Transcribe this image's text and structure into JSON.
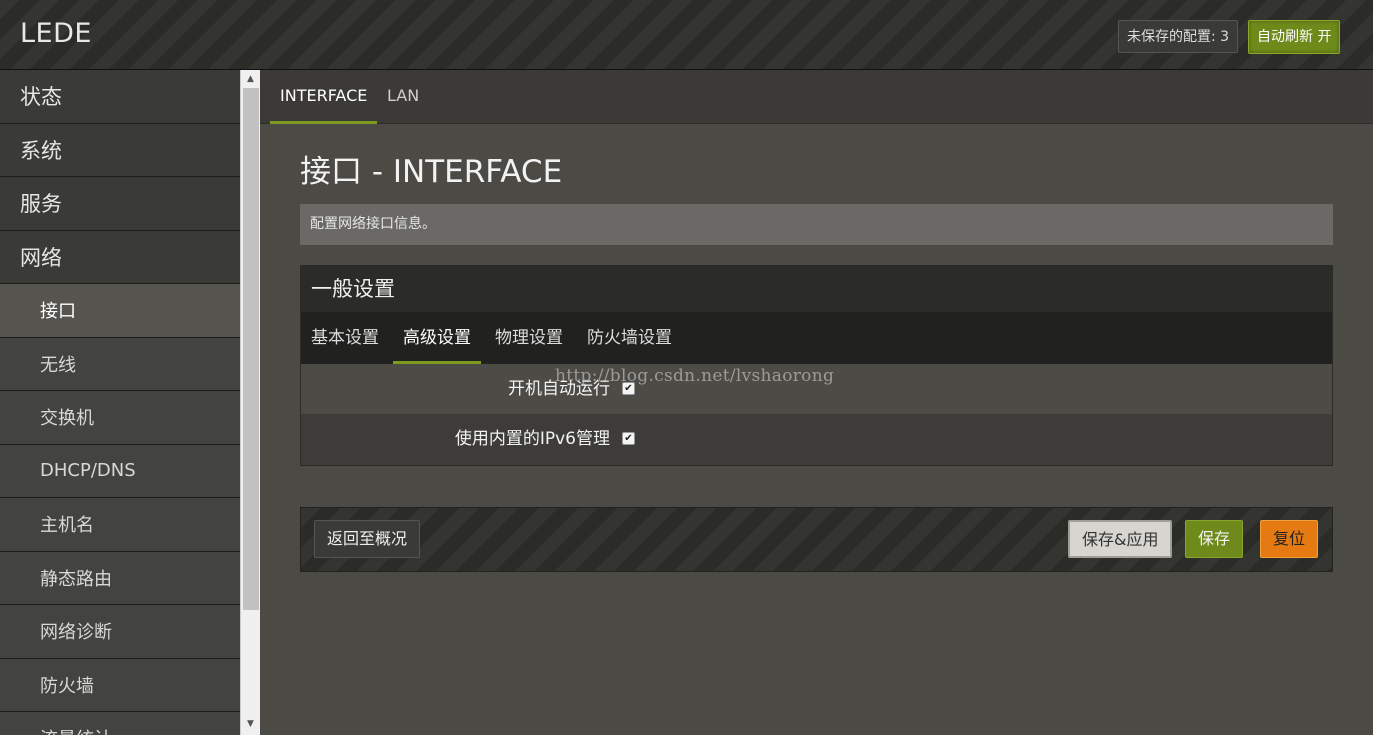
{
  "header": {
    "brand": "LEDE",
    "unsaved_label": "未保存的配置: 3",
    "autorefresh_label": "自动刷新 开"
  },
  "sidebar": {
    "items": [
      {
        "label": "状态",
        "level": 1
      },
      {
        "label": "系统",
        "level": 1
      },
      {
        "label": "服务",
        "level": 1
      },
      {
        "label": "网络",
        "level": 1
      },
      {
        "label": "接口",
        "level": 2,
        "active": true
      },
      {
        "label": "无线",
        "level": 2
      },
      {
        "label": "交换机",
        "level": 2
      },
      {
        "label": "DHCP/DNS",
        "level": 2
      },
      {
        "label": "主机名",
        "level": 2
      },
      {
        "label": "静态路由",
        "level": 2
      },
      {
        "label": "网络诊断",
        "level": 2
      },
      {
        "label": "防火墙",
        "level": 2
      },
      {
        "label": "流量统计",
        "level": 2
      }
    ]
  },
  "tabs": [
    {
      "label": "INTERFACE",
      "active": true
    },
    {
      "label": "LAN",
      "active": false
    }
  ],
  "page": {
    "title": "接口 - INTERFACE",
    "description": "配置网络接口信息。"
  },
  "section": {
    "title": "一般设置",
    "subtabs": [
      {
        "label": "基本设置",
        "active": false
      },
      {
        "label": "高级设置",
        "active": true
      },
      {
        "label": "物理设置",
        "active": false
      },
      {
        "label": "防火墙设置",
        "active": false
      }
    ],
    "options": [
      {
        "label": "开机自动运行",
        "checked": true
      },
      {
        "label": "使用内置的IPv6管理",
        "checked": true
      }
    ]
  },
  "watermark": "http://blog.csdn.net/lvshaorong",
  "actions": {
    "back_label": "返回至概况",
    "apply_label": "保存&应用",
    "save_label": "保存",
    "reset_label": "复位"
  },
  "colors": {
    "accent_green": "#6e8a1a",
    "reset_orange": "#e57a12",
    "background": "#4b4a45"
  }
}
